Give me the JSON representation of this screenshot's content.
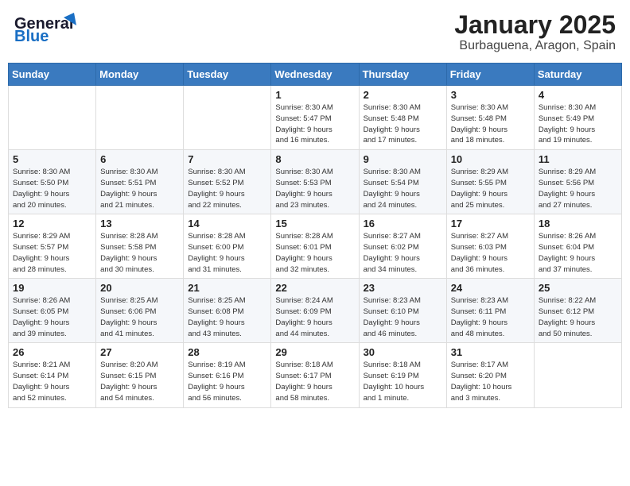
{
  "header": {
    "logo_line1": "General",
    "logo_line2": "Blue",
    "month_title": "January 2025",
    "location": "Burbaguena, Aragon, Spain"
  },
  "weekdays": [
    "Sunday",
    "Monday",
    "Tuesday",
    "Wednesday",
    "Thursday",
    "Friday",
    "Saturday"
  ],
  "weeks": [
    [
      {
        "day": "",
        "info": ""
      },
      {
        "day": "",
        "info": ""
      },
      {
        "day": "",
        "info": ""
      },
      {
        "day": "1",
        "info": "Sunrise: 8:30 AM\nSunset: 5:47 PM\nDaylight: 9 hours\nand 16 minutes."
      },
      {
        "day": "2",
        "info": "Sunrise: 8:30 AM\nSunset: 5:48 PM\nDaylight: 9 hours\nand 17 minutes."
      },
      {
        "day": "3",
        "info": "Sunrise: 8:30 AM\nSunset: 5:48 PM\nDaylight: 9 hours\nand 18 minutes."
      },
      {
        "day": "4",
        "info": "Sunrise: 8:30 AM\nSunset: 5:49 PM\nDaylight: 9 hours\nand 19 minutes."
      }
    ],
    [
      {
        "day": "5",
        "info": "Sunrise: 8:30 AM\nSunset: 5:50 PM\nDaylight: 9 hours\nand 20 minutes."
      },
      {
        "day": "6",
        "info": "Sunrise: 8:30 AM\nSunset: 5:51 PM\nDaylight: 9 hours\nand 21 minutes."
      },
      {
        "day": "7",
        "info": "Sunrise: 8:30 AM\nSunset: 5:52 PM\nDaylight: 9 hours\nand 22 minutes."
      },
      {
        "day": "8",
        "info": "Sunrise: 8:30 AM\nSunset: 5:53 PM\nDaylight: 9 hours\nand 23 minutes."
      },
      {
        "day": "9",
        "info": "Sunrise: 8:30 AM\nSunset: 5:54 PM\nDaylight: 9 hours\nand 24 minutes."
      },
      {
        "day": "10",
        "info": "Sunrise: 8:29 AM\nSunset: 5:55 PM\nDaylight: 9 hours\nand 25 minutes."
      },
      {
        "day": "11",
        "info": "Sunrise: 8:29 AM\nSunset: 5:56 PM\nDaylight: 9 hours\nand 27 minutes."
      }
    ],
    [
      {
        "day": "12",
        "info": "Sunrise: 8:29 AM\nSunset: 5:57 PM\nDaylight: 9 hours\nand 28 minutes."
      },
      {
        "day": "13",
        "info": "Sunrise: 8:28 AM\nSunset: 5:58 PM\nDaylight: 9 hours\nand 30 minutes."
      },
      {
        "day": "14",
        "info": "Sunrise: 8:28 AM\nSunset: 6:00 PM\nDaylight: 9 hours\nand 31 minutes."
      },
      {
        "day": "15",
        "info": "Sunrise: 8:28 AM\nSunset: 6:01 PM\nDaylight: 9 hours\nand 32 minutes."
      },
      {
        "day": "16",
        "info": "Sunrise: 8:27 AM\nSunset: 6:02 PM\nDaylight: 9 hours\nand 34 minutes."
      },
      {
        "day": "17",
        "info": "Sunrise: 8:27 AM\nSunset: 6:03 PM\nDaylight: 9 hours\nand 36 minutes."
      },
      {
        "day": "18",
        "info": "Sunrise: 8:26 AM\nSunset: 6:04 PM\nDaylight: 9 hours\nand 37 minutes."
      }
    ],
    [
      {
        "day": "19",
        "info": "Sunrise: 8:26 AM\nSunset: 6:05 PM\nDaylight: 9 hours\nand 39 minutes."
      },
      {
        "day": "20",
        "info": "Sunrise: 8:25 AM\nSunset: 6:06 PM\nDaylight: 9 hours\nand 41 minutes."
      },
      {
        "day": "21",
        "info": "Sunrise: 8:25 AM\nSunset: 6:08 PM\nDaylight: 9 hours\nand 43 minutes."
      },
      {
        "day": "22",
        "info": "Sunrise: 8:24 AM\nSunset: 6:09 PM\nDaylight: 9 hours\nand 44 minutes."
      },
      {
        "day": "23",
        "info": "Sunrise: 8:23 AM\nSunset: 6:10 PM\nDaylight: 9 hours\nand 46 minutes."
      },
      {
        "day": "24",
        "info": "Sunrise: 8:23 AM\nSunset: 6:11 PM\nDaylight: 9 hours\nand 48 minutes."
      },
      {
        "day": "25",
        "info": "Sunrise: 8:22 AM\nSunset: 6:12 PM\nDaylight: 9 hours\nand 50 minutes."
      }
    ],
    [
      {
        "day": "26",
        "info": "Sunrise: 8:21 AM\nSunset: 6:14 PM\nDaylight: 9 hours\nand 52 minutes."
      },
      {
        "day": "27",
        "info": "Sunrise: 8:20 AM\nSunset: 6:15 PM\nDaylight: 9 hours\nand 54 minutes."
      },
      {
        "day": "28",
        "info": "Sunrise: 8:19 AM\nSunset: 6:16 PM\nDaylight: 9 hours\nand 56 minutes."
      },
      {
        "day": "29",
        "info": "Sunrise: 8:18 AM\nSunset: 6:17 PM\nDaylight: 9 hours\nand 58 minutes."
      },
      {
        "day": "30",
        "info": "Sunrise: 8:18 AM\nSunset: 6:19 PM\nDaylight: 10 hours\nand 1 minute."
      },
      {
        "day": "31",
        "info": "Sunrise: 8:17 AM\nSunset: 6:20 PM\nDaylight: 10 hours\nand 3 minutes."
      },
      {
        "day": "",
        "info": ""
      }
    ]
  ]
}
